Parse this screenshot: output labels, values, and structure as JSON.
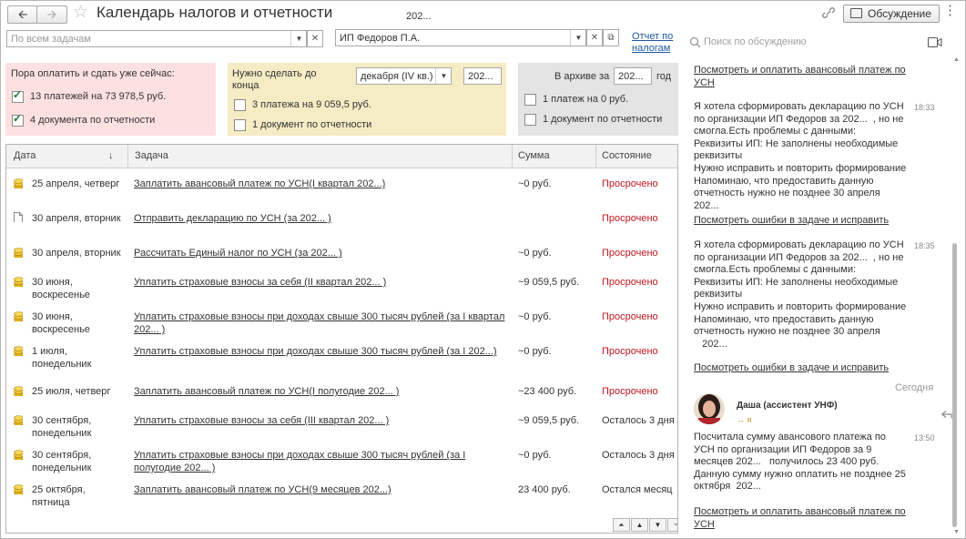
{
  "window": {
    "title": "Календарь налогов и отчетности",
    "discussion_button": "Обсуждение"
  },
  "colors": {
    "overdue": "#c0171f",
    "link": "#1a5a9c",
    "pink_panel": "#fde1e1",
    "yellow_panel": "#f5ebc4",
    "gray_panel": "#e4e4e4"
  },
  "filters": {
    "tasks_placeholder": "По всем задачам",
    "year_above": "202...",
    "organization": "ИП Федоров П.А.",
    "report_link_1": "Отчет по",
    "report_link_2": "налогам"
  },
  "panels": {
    "now": {
      "title": "Пора оплатить и сдать уже сейчас:",
      "items": [
        {
          "label": "13 платежей на 73 978,5 руб.",
          "checked": true
        },
        {
          "label": "4 документа по отчетности",
          "checked": true
        }
      ]
    },
    "until": {
      "title_1": "Нужно сделать до",
      "title_2": "конца",
      "period": "декабря (IV кв.)",
      "year": "202...",
      "items": [
        {
          "label": "3 платежа на 9 059,5 руб.",
          "checked": false
        },
        {
          "label": "1 документ по отчетности",
          "checked": false
        }
      ]
    },
    "archive": {
      "title": "В архиве за",
      "year": "202...",
      "year_suffix": "год",
      "items": [
        {
          "label": "1 платеж на 0 руб.",
          "checked": false
        },
        {
          "label": "1 документ по отчетности",
          "checked": false
        }
      ]
    }
  },
  "table": {
    "columns": {
      "date": "Дата",
      "sort_arrow": "↓",
      "task": "Задача",
      "sum": "Сумма",
      "state": "Состояние"
    },
    "rows": [
      {
        "icon": "coins",
        "date1": "25 апреля, четверг",
        "date2": "",
        "task1": "Заплатить авансовый платеж по УСН(I квартал  202...)",
        "task2": "",
        "sum": "~0 руб.",
        "state": "Просрочено",
        "overdue": true
      },
      {
        "icon": "doc",
        "date1": "30 апреля, вторник",
        "date2": "",
        "task1": "Отправить декларацию по УСН (за 202...  )",
        "task2": "",
        "sum": "",
        "state": "Просрочено",
        "overdue": true
      },
      {
        "icon": "coins",
        "date1": "30 апреля, вторник",
        "date2": "",
        "task1": "Рассчитать Единый налог по УСН (за 202...  )",
        "task2": "",
        "sum": "~0 руб.",
        "state": "Просрочено",
        "overdue": true
      },
      {
        "icon": "coins",
        "date1": "30 июня,",
        "date2": "воскресенье",
        "task1": "Уплатить страховые взносы за себя (II квартал  202...  )",
        "task2": "",
        "sum": "~9 059,5 руб.",
        "state": "Просрочено",
        "overdue": true
      },
      {
        "icon": "coins",
        "date1": "30 июня,",
        "date2": "воскресенье",
        "task1": "Уплатить страховые взносы при доходах свыше 300 тысяч рублей (за I квартал",
        "task2": "202...  )",
        "sum": "~0 руб.",
        "state": "Просрочено",
        "overdue": true
      },
      {
        "icon": "coins",
        "date1": "1 июля,",
        "date2": "понедельник",
        "task1": "Уплатить страховые взносы при доходах свыше 300 тысяч рублей (за  I  202...)",
        "task2": "",
        "sum": "~0 руб.",
        "state": "Просрочено",
        "overdue": true
      },
      {
        "icon": "coins",
        "date1": "25 июля, четверг",
        "date2": "",
        "task1": "Заплатить авансовый платеж по УСН(I полугодие 202...  )",
        "task2": "",
        "sum": "~23 400 руб.",
        "state": "Просрочено",
        "overdue": true
      },
      {
        "icon": "coins",
        "date1": "30 сентября,",
        "date2": "понедельник",
        "task1": "Уплатить страховые взносы за себя (III квартал  202...  )",
        "task2": "",
        "sum": "~9 059,5 руб.",
        "state": "Осталось 3 дня",
        "overdue": false
      },
      {
        "icon": "coins",
        "date1": "30 сентября,",
        "date2": "понедельник",
        "task1": "Уплатить страховые взносы при доходах свыше 300 тысяч рублей (за I",
        "task2": "полугодие 202...  )",
        "sum": "~0 руб.",
        "state": "Осталось 3 дня",
        "overdue": false
      },
      {
        "icon": "coins",
        "date1": "25 октября,",
        "date2": "пятница",
        "task1": "Заплатить авансовый платеж по УСН(9 месяцев  202...)",
        "task2": "",
        "sum": "23 400 руб.",
        "state": "Остался месяц",
        "overdue": false
      }
    ]
  },
  "chat": {
    "search_placeholder": "Поиск по обсуждению",
    "top_link": "Посмотреть и оплатить авансовый платеж по\nУСН",
    "messages": [
      {
        "text": "Я хотела сформировать декларацию по УСН\nпо организации ИП Федоров за 202...  , но не\nсмогла.Есть проблемы с данными:\nРеквизиты ИП: Не заполнены необходимые\nреквизиты\nНужно исправить и повторить формирование\nНапоминаю, что предоставить данную\nотчетность нужно не позднее 30 апреля\n202...",
        "time": "18:33",
        "link": "Посмотреть ошибки в задаче и исправить"
      },
      {
        "text": "Я хотела сформировать декларацию по УСН\nпо организации ИП Федоров за 202...  , но не\nсмогла.Есть проблемы с данными:\nРеквизиты ИП: Не заполнены необходимые\nреквизиты\nНужно исправить и повторить формирование\nНапоминаю, что предоставить данную\nотчетность нужно не позднее 30 апреля\n   202...",
        "time": "18:35",
        "link": "Посмотреть ошибки в задаче и исправить"
      }
    ],
    "day_separator": "Сегодня",
    "author": "Даша (ассистент УНФ)",
    "to_me": "→ я",
    "last_message": "Посчитала сумму авансового платежа по\nУСН по организации ИП Федоров за 9\nмесяцев 202...   получилось 23 400 руб.\nДанную сумму нужно оплатить не позднее 25\nоктября  202...",
    "last_time": "13:50",
    "last_link": "Посмотреть и оплатить авансовый платеж по\nУСН"
  }
}
